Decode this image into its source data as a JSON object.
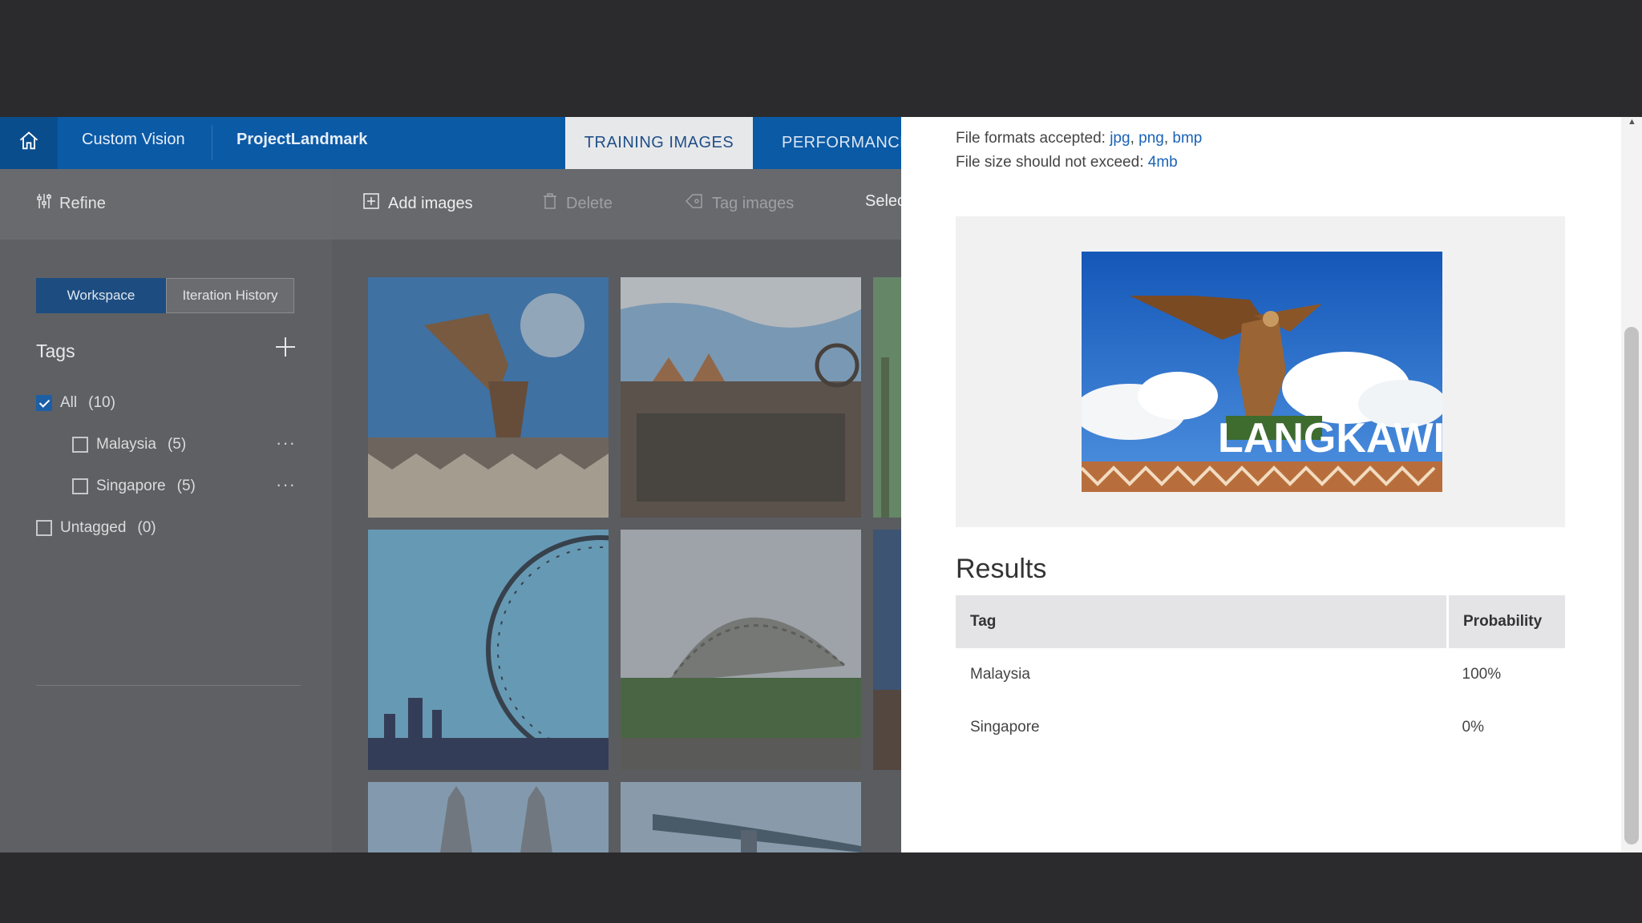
{
  "nav": {
    "brand": "Custom Vision",
    "project": "ProjectLandmark",
    "tabs": [
      {
        "label": "TRAINING IMAGES",
        "active": true
      },
      {
        "label": "PERFORMANCE",
        "active": false
      }
    ]
  },
  "sidebar": {
    "refine_label": "Refine",
    "segments": {
      "workspace": "Workspace",
      "iteration_history": "Iteration History"
    },
    "tags_title": "Tags",
    "tags": [
      {
        "label": "All",
        "count": "(10)",
        "checked": true
      },
      {
        "label": "Malaysia",
        "count": "(5)",
        "checked": false
      },
      {
        "label": "Singapore",
        "count": "(5)",
        "checked": false
      },
      {
        "label": "Untagged",
        "count": "(0)",
        "checked": false
      }
    ],
    "more_glyph": "···"
  },
  "toolbar": {
    "add_images": "Add images",
    "delete": "Delete",
    "tag_images": "Tag images",
    "select": "Selec"
  },
  "panel": {
    "formats_label": "File formats accepted:",
    "formats": [
      "jpg",
      "png",
      "bmp"
    ],
    "size_label": "File size should not exceed:",
    "size_value": "4mb",
    "preview_text": "LANGKAWI",
    "results_title": "Results",
    "table": {
      "headers": [
        "Tag",
        "Probability"
      ],
      "rows": [
        {
          "tag": "Malaysia",
          "probability": "100%"
        },
        {
          "tag": "Singapore",
          "probability": "0%"
        }
      ]
    }
  },
  "colors": {
    "nav_blue": "#0b5aa6",
    "accent_blue": "#1d5fa6",
    "link": "#1a63b6"
  }
}
